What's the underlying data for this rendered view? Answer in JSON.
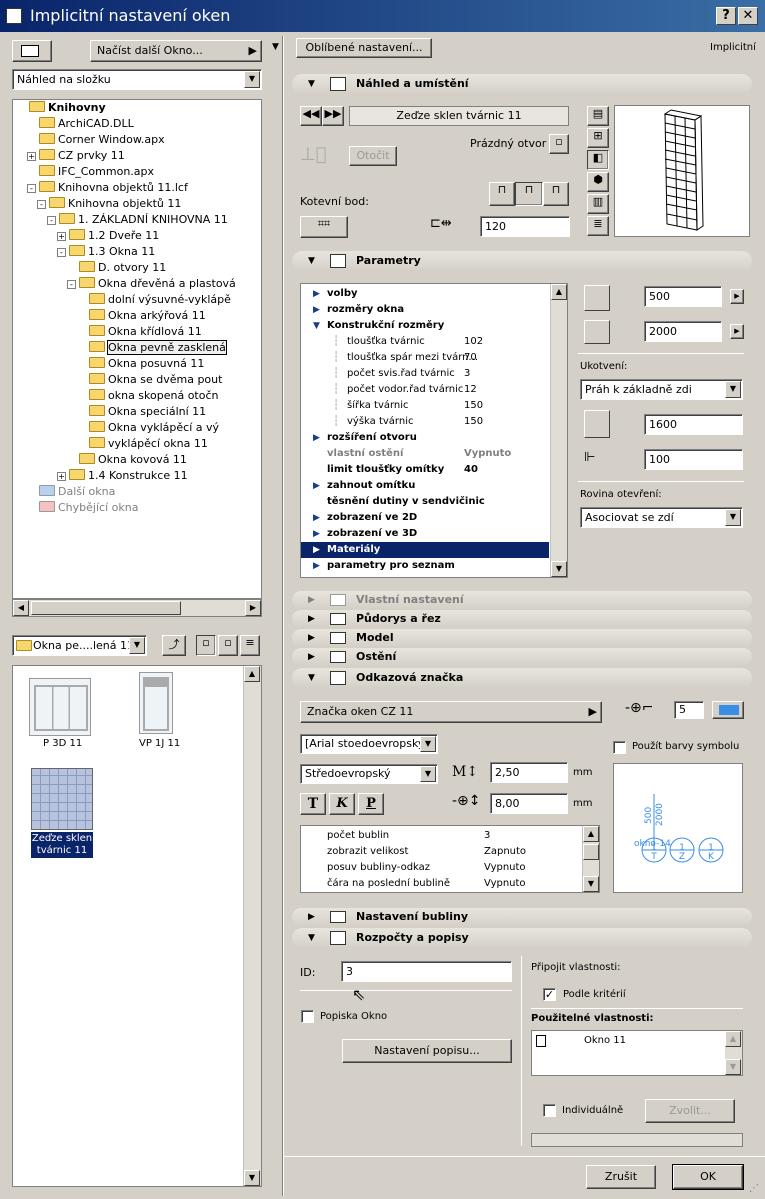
{
  "window": {
    "title": "Implicitní nastavení oken",
    "help": "?",
    "close": "✕"
  },
  "left": {
    "load_button": "Načíst další Okno...",
    "view_select": "Náhled na složku",
    "tree": [
      {
        "label": "Knihovny",
        "level": 0,
        "bold": true,
        "exp": ""
      },
      {
        "label": "ArchiCAD.DLL",
        "level": 1,
        "exp": ""
      },
      {
        "label": "Corner Window.apx",
        "level": 1,
        "exp": ""
      },
      {
        "label": "CZ prvky 11",
        "level": 1,
        "exp": "+"
      },
      {
        "label": "IFC_Common.apx",
        "level": 1,
        "exp": ""
      },
      {
        "label": "Knihovna objektů 11.lcf",
        "level": 1,
        "exp": "-"
      },
      {
        "label": "Knihovna objektů 11",
        "level": 2,
        "exp": "-"
      },
      {
        "label": "1. ZÁKLADNÍ KNIHOVNA 11",
        "level": 3,
        "exp": "-"
      },
      {
        "label": "1.2 Dveře 11",
        "level": 4,
        "exp": "+"
      },
      {
        "label": "1.3 Okna 11",
        "level": 4,
        "exp": "-"
      },
      {
        "label": "D. otvory 11",
        "level": 5,
        "exp": ""
      },
      {
        "label": "Okna dřevěná a plastová",
        "level": 5,
        "exp": "-"
      },
      {
        "label": "dolní výsuvné-vyklápě",
        "level": 6,
        "exp": ""
      },
      {
        "label": "Okna arkýřová 11",
        "level": 6,
        "exp": ""
      },
      {
        "label": "Okna křídlová 11",
        "level": 6,
        "exp": ""
      },
      {
        "label": "Okna pevně zasklená",
        "level": 6,
        "exp": "",
        "sel": true
      },
      {
        "label": "Okna posuvná 11",
        "level": 6,
        "exp": ""
      },
      {
        "label": "Okna se dvěma pout",
        "level": 6,
        "exp": ""
      },
      {
        "label": "okna skopená otočn",
        "level": 6,
        "exp": ""
      },
      {
        "label": "Okna speciální 11",
        "level": 6,
        "exp": ""
      },
      {
        "label": "Okna vyklápěcí a vý",
        "level": 6,
        "exp": ""
      },
      {
        "label": "vyklápěcí okna 11",
        "level": 6,
        "exp": ""
      },
      {
        "label": "Okna kovová 11",
        "level": 5,
        "exp": ""
      },
      {
        "label": "1.4 Konstrukce 11",
        "level": 4,
        "exp": "+"
      },
      {
        "label": "Další okna",
        "level": 1,
        "exp": "",
        "grey": true
      },
      {
        "label": "Chybějící okna",
        "level": 1,
        "exp": "",
        "grey": true
      }
    ],
    "folder_select": "Okna pe....lená 11",
    "thumbs": [
      {
        "label": "P 3D 11"
      },
      {
        "label": "VP 1J 11"
      },
      {
        "label": "Zeďze sklen tvárnic 11",
        "sel": true
      }
    ]
  },
  "right": {
    "fav_button": "Oblíbené nastavení...",
    "mode": "Implicitní",
    "sec_nahled": "Náhled a umístění",
    "object_name": "Zeďze sklen tvárnic 11",
    "empty_opening": "Prázdný otvor",
    "rotate": "Otočit",
    "anchor": "Kotevní bod:",
    "anchor_val": "120",
    "sec_param": "Parametry",
    "params": [
      {
        "label": "volby",
        "cls": "b",
        "tri": "▶"
      },
      {
        "label": "rozměry okna",
        "cls": "b",
        "tri": "▶"
      },
      {
        "label": "Konstrukční rozměry",
        "cls": "b",
        "tri": "▼"
      },
      {
        "label": "tloušťka tvárnic",
        "cls": "sub",
        "v": "102"
      },
      {
        "label": "tloušťka spár mezi tvárn...",
        "cls": "sub",
        "v": "70"
      },
      {
        "label": "počet svis.řad tvárnic",
        "cls": "sub",
        "v": "3"
      },
      {
        "label": "počet vodor.řad tvárnic",
        "cls": "sub",
        "v": "12"
      },
      {
        "label": "šířka tvárnic",
        "cls": "sub",
        "v": "150"
      },
      {
        "label": "výška tvárnic",
        "cls": "sub",
        "v": "150"
      },
      {
        "label": "rozšíření otvoru",
        "cls": "b",
        "tri": "▶"
      },
      {
        "label": "vlastní ostění",
        "cls": "g b",
        "v": "Vypnuto"
      },
      {
        "label": "limit tloušťky omítky",
        "cls": "b",
        "v": "40"
      },
      {
        "label": "zahnout omítku",
        "cls": "b",
        "tri": "▶"
      },
      {
        "label": "těsnění dutiny v sendvičinic",
        "cls": "b"
      },
      {
        "label": "zobrazení ve 2D",
        "cls": "b",
        "tri": "▶"
      },
      {
        "label": "zobrazení ve 3D",
        "cls": "b",
        "tri": "▶"
      },
      {
        "label": "Materiály",
        "cls": "b sel",
        "tri": "▶"
      },
      {
        "label": "parametry pro seznam",
        "cls": "b",
        "tri": "▶"
      }
    ],
    "width": "500",
    "height": "2000",
    "anchoring_label": "Ukotvení:",
    "anchoring": "Práh k základně zdi",
    "sill": "1600",
    "sill2": "100",
    "opening_plane_label": "Rovina otevření:",
    "opening_plane": "Asociovat se zdí",
    "sections": [
      "Vlastní nastavení",
      "Půdorys a řez",
      "Model",
      "Ostění"
    ],
    "sec_marker": "Odkazová značka",
    "marker_select": "Značka oken CZ 11",
    "marker_num": "5",
    "font": "[Arial stoedoevropský]",
    "charset": "Středoevropský",
    "use_symbol_colors": "Použít barvy symbolu",
    "text_size": "2,50",
    "text_size2": "8,00",
    "unit": "mm",
    "style_t": "T",
    "style_k": "K",
    "style_p": "P",
    "marker_params": [
      {
        "label": "počet bublin",
        "v": "3"
      },
      {
        "label": "zobrazit velikost",
        "v": "Zapnuto"
      },
      {
        "label": "posuv bubliny-odkaz",
        "v": "Vypnuto"
      },
      {
        "label": "čára na poslední bublině",
        "v": "Vypnuto"
      }
    ],
    "preview_text": "okno-14",
    "bubbles": [
      "1 T",
      "1 Z",
      "1 K"
    ],
    "preview_nums": [
      "500",
      "2000"
    ],
    "sec_bubble": "Nastavení bubliny",
    "sec_listing": "Rozpočty a popisy",
    "id_label": "ID:",
    "id_val": "3",
    "label_window": "Popiska Okno",
    "label_settings": "Nastavení popisu...",
    "attach": "Připojit vlastnosti:",
    "by_criteria": "Podle kritérií",
    "usable": "Použitelné vlastnosti:",
    "prop_item": "Okno 11",
    "individual": "Individuálně",
    "choose": "Zvolit...",
    "cancel": "Zrušit",
    "ok": "OK"
  }
}
